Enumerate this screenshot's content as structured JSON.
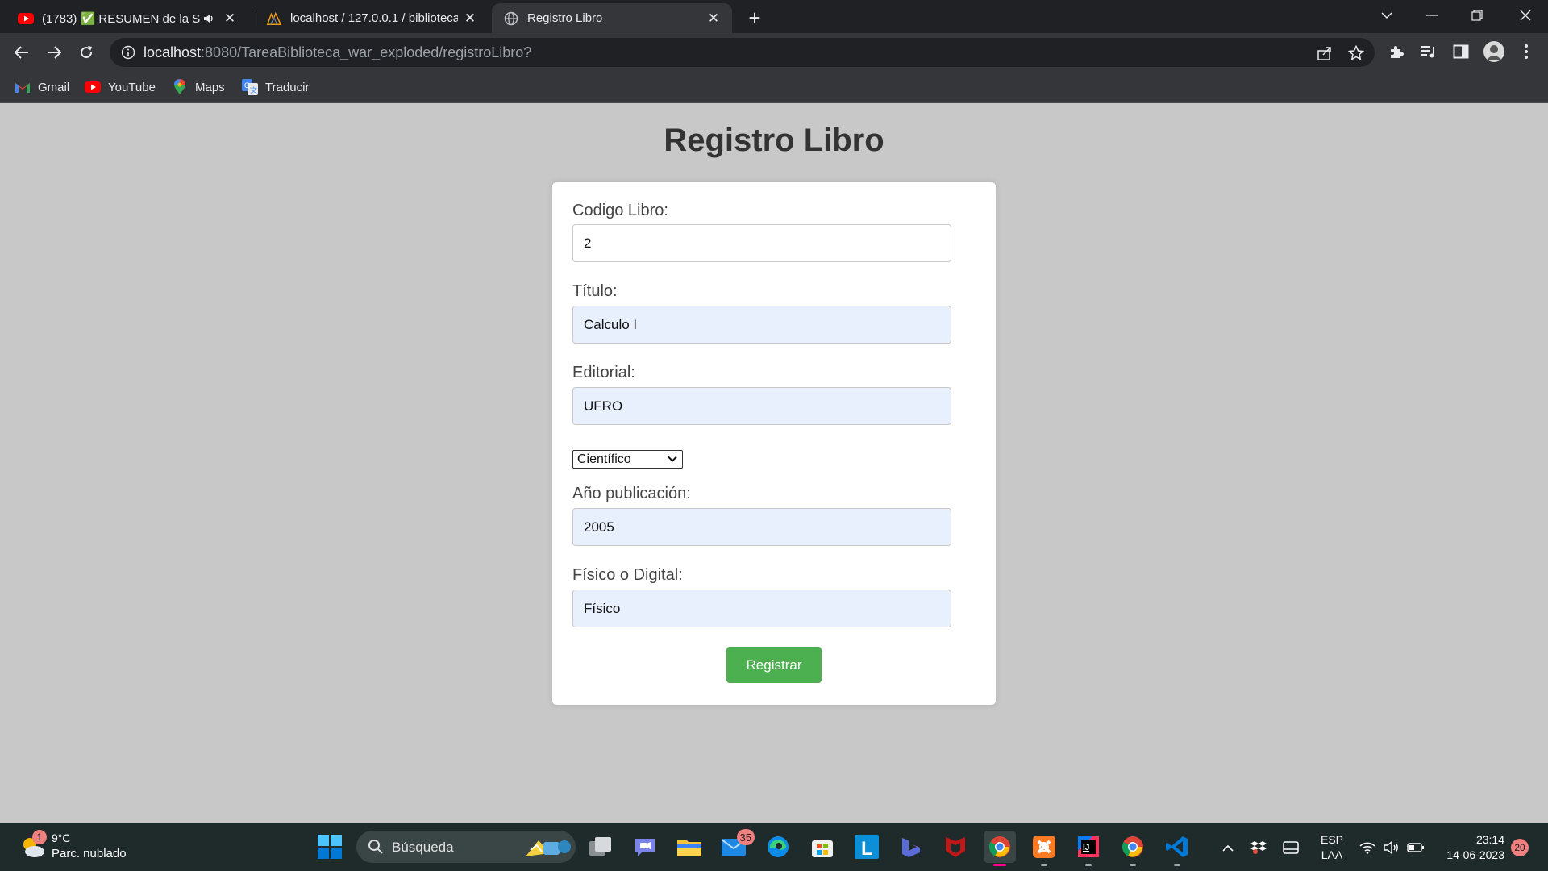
{
  "browser": {
    "tabs": [
      {
        "title": "(1783) ✅ RESUMEN de la SE",
        "favicon": "youtube-icon",
        "audio": "speaker-icon",
        "active": false
      },
      {
        "title": "localhost / 127.0.0.1 / bibliotecad",
        "favicon": "phpmyadmin-icon",
        "active": false
      },
      {
        "title": "Registro Libro",
        "favicon": "globe-icon",
        "active": true
      }
    ],
    "url_host": "localhost",
    "url_rest": ":8080/TareaBiblioteca_war_exploded/registroLibro?",
    "bookmarks": [
      {
        "label": "Gmail",
        "icon": "gmail-icon"
      },
      {
        "label": "YouTube",
        "icon": "youtube-icon"
      },
      {
        "label": "Maps",
        "icon": "maps-icon"
      },
      {
        "label": "Traducir",
        "icon": "translate-icon"
      }
    ]
  },
  "form": {
    "title": "Registro Libro",
    "codigo_label": "Codigo Libro:",
    "codigo_value": "2",
    "titulo_label": "Título:",
    "titulo_value": "Calculo I",
    "editorial_label": "Editorial:",
    "editorial_value": "UFRO",
    "categoria_selected": "Científico",
    "anio_label": "Año publicación:",
    "anio_value": "2005",
    "formato_label": "Físico o Digital:",
    "formato_value": "Físico",
    "submit_label": "Registrar"
  },
  "taskbar": {
    "weather_badge": "1",
    "temperature": "9°C",
    "condition": "Parc. nublado",
    "search_label": "Búsqueda",
    "mail_badge": "35",
    "lang_1": "ESP",
    "lang_2": "LAA",
    "time": "23:14",
    "date": "14-06-2023",
    "notifications": "20"
  },
  "colors": {
    "page_bg": "#c8c8c8",
    "autofill_bg": "#e8f0fe",
    "submit_bg": "#4caf50",
    "chrome_dark": "#202124",
    "chrome_toolbar": "#35363a"
  }
}
